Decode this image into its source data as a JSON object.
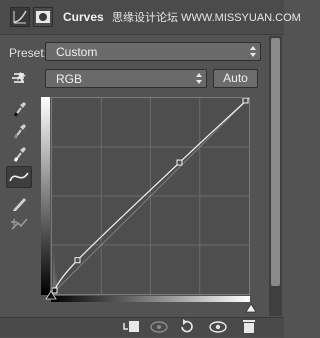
{
  "header": {
    "title": "Curves",
    "watermark": "思缘设计论坛 WWW.MISSYUAN.COM",
    "icons": [
      "adjustment-layer-icon",
      "layer-mask-icon"
    ]
  },
  "preset": {
    "label": "Preset:",
    "value": "Custom"
  },
  "channel": {
    "value": "RGB"
  },
  "auto_button": {
    "label": "Auto"
  },
  "tools": [
    "on-image-adjust-icon",
    "black-point-eyedropper-icon",
    "gray-point-eyedropper-icon",
    "white-point-eyedropper-icon",
    "curve-points-icon",
    "pencil-draw-icon",
    "smooth-icon"
  ],
  "curve": {
    "points": [
      [
        0,
        0
      ],
      [
        33,
        44
      ],
      [
        165,
        171
      ],
      [
        255,
        255
      ]
    ]
  },
  "bottom_bar": {
    "icons": [
      "clip-to-layer-icon",
      "view-previous-icon",
      "reset-icon",
      "visibility-eye-icon",
      "delete-icon"
    ]
  },
  "colors": {
    "panel_bg": "#535353",
    "header_bg": "#4b4b4b",
    "field_bg": "#6a6a6a",
    "graph_bg": "#4e4e4e"
  }
}
